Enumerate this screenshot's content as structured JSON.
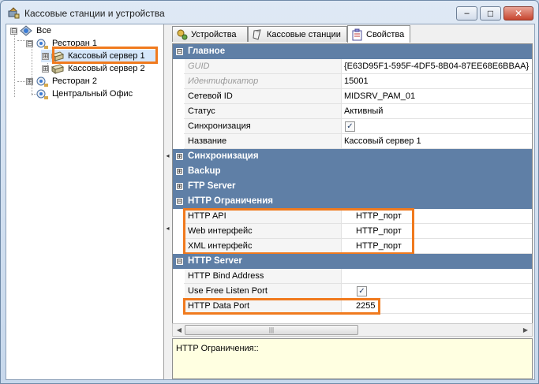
{
  "window": {
    "title": "Кассовые станции и устройства",
    "controls": {
      "minimize": "‒",
      "maximize": "□",
      "close": "✕"
    }
  },
  "tree": {
    "root": {
      "label": "Все",
      "icon": "network-group-icon"
    },
    "items": [
      {
        "label": "Ресторан 1",
        "icon": "network-node-icon"
      },
      {
        "label": "Кассовый сервер 1",
        "icon": "cash-server-icon"
      },
      {
        "label": "Кассовый сервер 2",
        "icon": "cash-server-icon"
      },
      {
        "label": "Ресторан 2",
        "icon": "network-node-icon"
      },
      {
        "label": "Центральный Офис",
        "icon": "network-node-icon"
      }
    ]
  },
  "tabs": [
    {
      "label": "Устройства",
      "icon": "devices-icon"
    },
    {
      "label": "Кассовые станции",
      "icon": "cash-register-icon"
    },
    {
      "label": "Свойства",
      "icon": "properties-icon",
      "active": true
    }
  ],
  "grid": {
    "main": {
      "title": "Главное",
      "rows": [
        {
          "name": "GUID",
          "value": "{E63D95F1-595F-4DF5-8B04-87EE68E6BBAA}",
          "disabled": true
        },
        {
          "name": "Идентификатор",
          "value": "15001",
          "disabled": true
        },
        {
          "name": "Сетевой ID",
          "value": "MIDSRV_PAM_01"
        },
        {
          "name": "Статус",
          "value": "Активный"
        },
        {
          "name": "Синхронизация",
          "value": "✓"
        },
        {
          "name": "Название",
          "value": "Кассовый сервер 1"
        }
      ]
    },
    "sections_collapsed": [
      "Синхронизация",
      "Backup",
      "FTP Server"
    ],
    "http_limits": {
      "title": "HTTP Ограничения",
      "rows": [
        {
          "name": "HTTP API",
          "value": "HTTP_порт"
        },
        {
          "name": "Web интерфейс",
          "value": "HTTP_порт"
        },
        {
          "name": "XML интерфейс",
          "value": "HTTP_порт"
        }
      ]
    },
    "http_server": {
      "title": "HTTP Server",
      "rows": [
        {
          "name": "HTTP Bind Address",
          "value": ""
        },
        {
          "name": "Use Free Listen Port",
          "value": "✓"
        },
        {
          "name": "HTTP Data Port",
          "value": "2255"
        }
      ]
    },
    "expander_open": "⊟",
    "expander_closed": "⊞"
  },
  "description": "HTTP Ограничения::",
  "colors": {
    "section_header": "#5f7fa6",
    "highlight": "#f07a1e",
    "description_bg": "#ffffe1"
  }
}
